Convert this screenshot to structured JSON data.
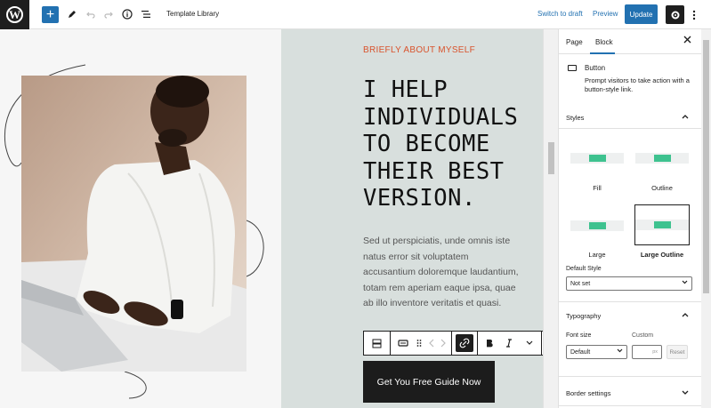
{
  "topbar": {
    "logo_letter": "W",
    "add": "+",
    "title": "Template Library",
    "switch_draft": "Switch to draft",
    "preview": "Preview",
    "update": "Update"
  },
  "content": {
    "eyebrow": "BRIEFLY ABOUT MYSELF",
    "heading_lines": [
      "I HELP",
      "INDIVIDUALS",
      "TO BECOME",
      "THEIR BEST",
      "VERSION."
    ],
    "body_lines": [
      "Sed ut perspiciatis, unde omnis iste",
      "natus error sit voluptatem",
      "accusantium doloremque laudantium,",
      "totam rem aperiam eaque ipsa, quae",
      "ab illo inventore veritatis et quasi."
    ],
    "cta_label": "Get You Free Guide Now"
  },
  "sidebar": {
    "tab_page": "Page",
    "tab_block": "Block",
    "block_name": "Button",
    "block_desc": "Prompt visitors to take action with a button-style link.",
    "styles_head": "Styles",
    "style_options": [
      "Fill",
      "Outline",
      "Large",
      "Large Outline"
    ],
    "selected_style": "Large Outline",
    "default_style_label": "Default Style",
    "default_style_value": "Not set",
    "typography_head": "Typography",
    "font_size_label": "Font size",
    "custom_label": "Custom",
    "font_size_value": "Default",
    "custom_unit": "px",
    "reset": "Reset",
    "border_head": "Border settings"
  },
  "colors": {
    "accent": "#2271b1",
    "eyebrow": "#d9532c",
    "style_pill": "#3ec28f"
  }
}
